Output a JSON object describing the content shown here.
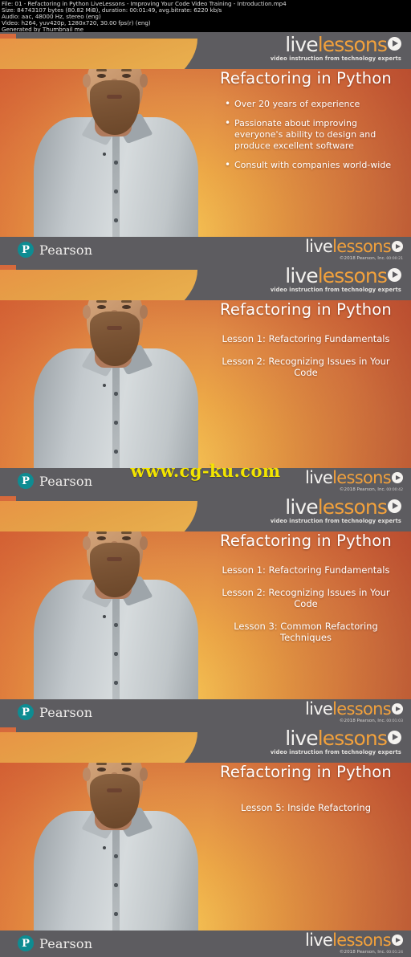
{
  "meta": {
    "lines": [
      "File: 01 - Refactoring in Python LiveLessons - Improving Your Code Video Training - Introduction.mp4",
      "Size: 84743107 bytes (80.82 MiB), duration: 00:01:49, avg.bitrate: 6220 kb/s",
      "Audio: aac, 48000 Hz, stereo (eng)",
      "Video: h264, yuv420p, 1280x720, 30.00 fps(r) (eng)",
      "Generated by Thumbnail me"
    ]
  },
  "brand": {
    "live": "live",
    "lessons": "lessons",
    "tagline": "video instruction from technology experts",
    "pearson": "Pearson",
    "pearson_initial": "P",
    "copyright": "©2018 Pearson, Inc.",
    "play_icon": "play-circle-icon"
  },
  "watermark": "www.cg-ku.com",
  "colors": {
    "band": "#5d5c60",
    "accent_orange": "#f2a13c",
    "pearson_teal": "#0e8c92",
    "watermark_yellow": "#f2e400",
    "gradient_light": "#f5c253",
    "gradient_dark": "#b5452e"
  },
  "frames": [
    {
      "title": "Refactoring in Python",
      "kind": "bullets",
      "bullets": [
        "Over 20 years of experience",
        "Passionate about improving everyone's ability to design and produce excellent software",
        "Consult with companies world-wide"
      ],
      "lessons": [],
      "timecode": "00:00:21"
    },
    {
      "title": "Refactoring in Python",
      "kind": "lessons",
      "bullets": [],
      "lessons": [
        "Lesson 1: Refactoring Fundamentals",
        "Lesson 2: Recognizing Issues in Your Code"
      ],
      "timecode": "00:00:42"
    },
    {
      "title": "Refactoring in Python",
      "kind": "lessons",
      "bullets": [],
      "lessons": [
        "Lesson 1: Refactoring Fundamentals",
        "Lesson 2: Recognizing Issues in Your Code",
        "Lesson 3: Common Refactoring Techniques"
      ],
      "timecode": "00:01:03"
    },
    {
      "title": "Refactoring in Python",
      "kind": "lessons-single",
      "bullets": [],
      "lessons": [
        "Lesson 5: Inside Refactoring"
      ],
      "timecode": "00:01:24"
    }
  ]
}
